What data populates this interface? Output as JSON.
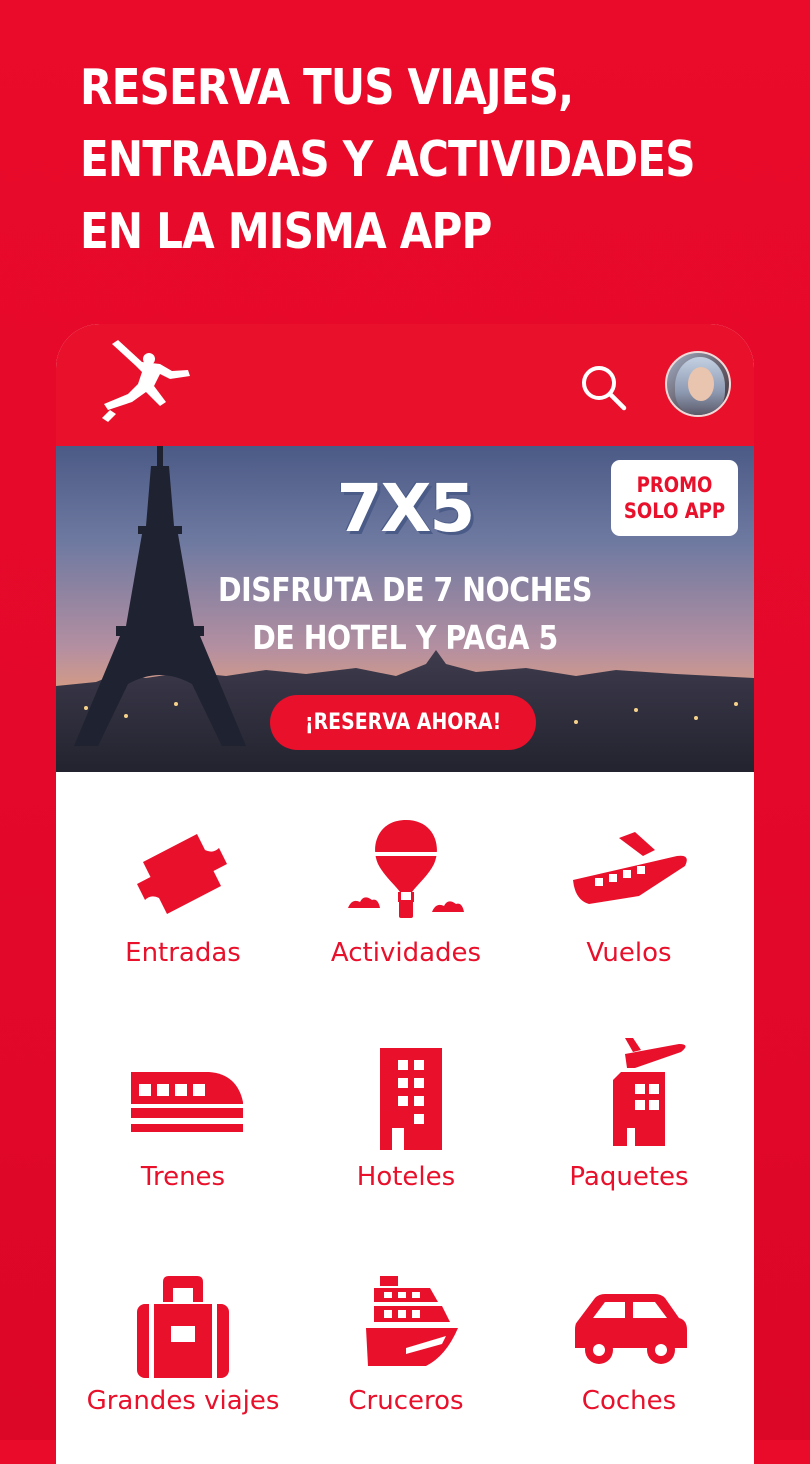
{
  "headline": {
    "line1": "RESERVA TUS VIAJES,",
    "line2": "ENTRADAS Y ACTIVIDADES",
    "line3": "EN LA MISMA APP"
  },
  "banner": {
    "title": "7X5",
    "line1": "DISFRUTA DE 7 NOCHES",
    "line2": "DE HOTEL Y PAGA 5",
    "badge_line1": "PROMO",
    "badge_line2": "SOLO APP",
    "cta": "¡RESERVA AHORA!"
  },
  "categories": [
    {
      "label": "Entradas",
      "icon": "ticket-icon"
    },
    {
      "label": "Actividades",
      "icon": "hot-air-balloon-icon"
    },
    {
      "label": "Vuelos",
      "icon": "airplane-icon"
    },
    {
      "label": "Trenes",
      "icon": "train-icon"
    },
    {
      "label": "Hoteles",
      "icon": "hotel-building-icon"
    },
    {
      "label": "Paquetes",
      "icon": "package-plane-hotel-icon"
    },
    {
      "label": "Grandes viajes",
      "icon": "suitcase-icon"
    },
    {
      "label": "Cruceros",
      "icon": "cruise-ship-icon"
    },
    {
      "label": "Coches",
      "icon": "car-icon"
    }
  ],
  "colors": {
    "brand_red": "#e8102b",
    "background": "#ea0a2a",
    "card": "#ffffff"
  }
}
